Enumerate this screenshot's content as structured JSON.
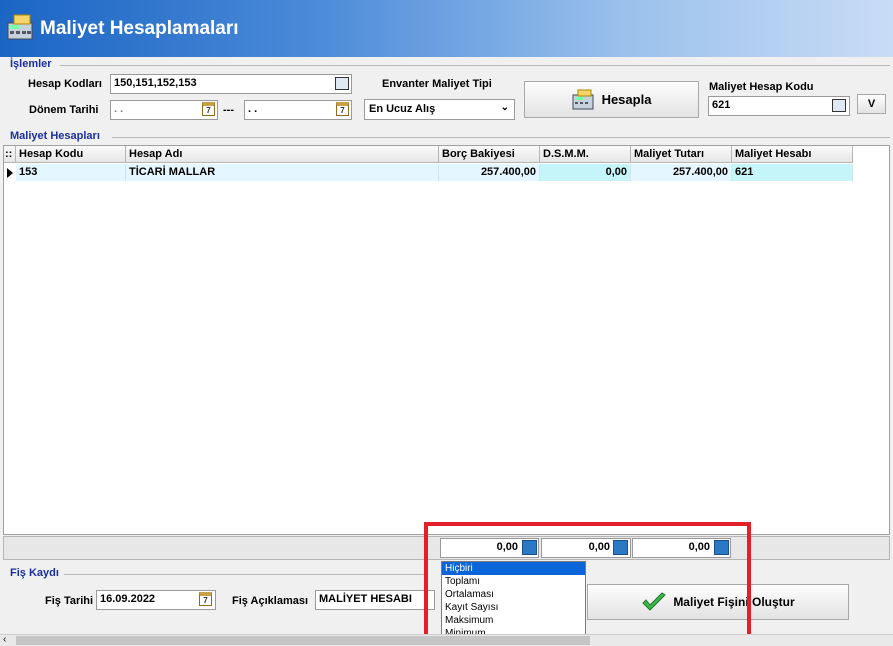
{
  "window": {
    "title": "Maliyet Hesaplamaları"
  },
  "islemler": {
    "section_title": "İşlemler",
    "hesap_kodlari_label": "Hesap Kodları",
    "hesap_kodlari_value": "150,151,152,153",
    "donem_tarihi_label": "Dönem Tarihi",
    "donem_start_value": ". .",
    "donem_separator": "---",
    "donem_end_value": ". .",
    "envanter_label": "Envanter Maliyet Tipi",
    "envanter_value": "En Ucuz Alış",
    "hesapla_button": "Hesapla",
    "maliyet_hesap_kodu_label": "Maliyet Hesap Kodu",
    "maliyet_hesap_kodu_value": "621",
    "v_button": "V",
    "calendar_glyph": "7"
  },
  "maliyet_hesaplari": {
    "section_title": "Maliyet Hesapları",
    "columns": [
      "Hesap Kodu",
      "Hesap Adı",
      "Borç Bakiyesi",
      "D.S.M.M.",
      "Maliyet Tutarı",
      "Maliyet Hesabı"
    ],
    "row_marker": "::",
    "rows": [
      {
        "hesap_kodu": "153",
        "hesap_adi": "TİCARİ MALLAR",
        "borc_bakiyesi": "257.400,00",
        "dsmm": "0,00",
        "maliyet_tutari": "257.400,00",
        "maliyet_hesabi": "621"
      }
    ]
  },
  "footer_totals": {
    "values": [
      "0,00",
      "0,00",
      "0,00"
    ]
  },
  "summary_dropdown": {
    "options": [
      "Hiçbiri",
      "Toplamı",
      "Ortalaması",
      "Kayıt Sayısı",
      "Maksimum",
      "Minimum"
    ],
    "selected": "Hiçbiri"
  },
  "fis_kaydi": {
    "section_title": "Fiş Kaydı",
    "fis_tarihi_label": "Fiş Tarihi",
    "fis_tarihi_value": "16.09.2022",
    "fis_aciklamasi_label": "Fiş Açıklaması",
    "fis_aciklamasi_value": "MALİYET HESABI",
    "olustur_button": "Maliyet Fişini Oluştur"
  },
  "colors": {
    "title_blue": "#1b65c4",
    "section_blue": "#1a2fa0",
    "highlight_red": "#e3202a",
    "row_highlight": "#e4f6ff",
    "selection_blue": "#0a66d8"
  }
}
